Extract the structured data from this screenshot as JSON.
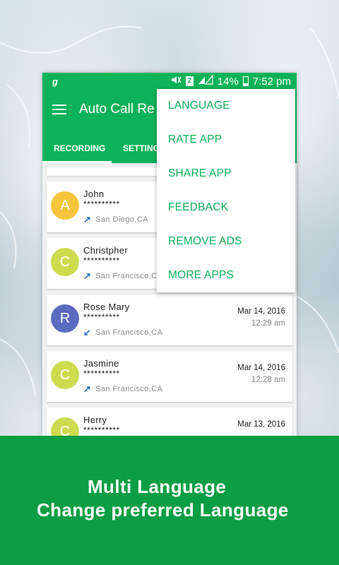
{
  "status_bar": {
    "carrier_glyph": "g",
    "sim": "2",
    "battery": "14%",
    "time": "7:52 pm"
  },
  "toolbar": {
    "title": "Auto Call Re"
  },
  "tabs": [
    {
      "label": "RECORDING"
    },
    {
      "label": "SETTING"
    }
  ],
  "calls": [
    {
      "initial": "A",
      "name": "John",
      "number": "**********",
      "direction": "outgoing",
      "location": "San Diego,CA",
      "date": "",
      "time": "",
      "avatar_color": "#f5c53b"
    },
    {
      "initial": "C",
      "name": "Christpher",
      "number": "**********",
      "direction": "outgoing",
      "location": "San Francisco,CA",
      "date": "",
      "time": "",
      "avatar_color": "#cddc4f"
    },
    {
      "initial": "R",
      "name": "Rose Mary",
      "number": "**********",
      "direction": "incoming",
      "location": "San Francisco,CA",
      "date": "Mar 14, 2016",
      "time": "12:29 am",
      "avatar_color": "#5c6bc0"
    },
    {
      "initial": "C",
      "name": "Jasmine",
      "number": "**********",
      "direction": "outgoing",
      "location": "San Francisco,CA",
      "date": "Mar 14, 2016",
      "time": "12:28 am",
      "avatar_color": "#cddc4f"
    },
    {
      "initial": "C",
      "name": "Herry",
      "number": "**********",
      "direction": "outgoing",
      "location": "",
      "date": "Mar 13, 2016",
      "time": "",
      "avatar_color": "#cddc4f"
    }
  ],
  "menu": {
    "items": [
      "LANGUAGE",
      "RATE APP",
      "SHARE APP",
      "FEEDBACK",
      "REMOVE ADS",
      "MORE APPS"
    ]
  },
  "banner": {
    "line1": "Multi Language",
    "line2": "Change preferred Language"
  },
  "colors": {
    "primary": "#0cb35a",
    "banner": "#0c9e44",
    "outgoing_arrow": "#2a6fb8"
  }
}
